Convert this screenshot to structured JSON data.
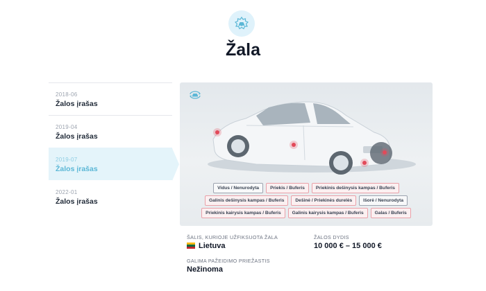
{
  "header": {
    "icon": "car-damage-icon",
    "title": "Žala"
  },
  "timeline": [
    {
      "date": "2018-06",
      "label": "Žalos įrašas",
      "active": false
    },
    {
      "date": "2019-04",
      "label": "Žalos įrašas",
      "active": false
    },
    {
      "date": "2019-07",
      "label": "Žalos įrašas",
      "active": true
    },
    {
      "date": "2022-01",
      "label": "Žalos įrašas",
      "active": false
    }
  ],
  "car_view": {
    "rotate_icon": "rotate-view-icon",
    "tag_rows": [
      [
        {
          "label": "Vidus / Nenurodyta",
          "damaged": false
        },
        {
          "label": "Priekis / Buferis",
          "damaged": true
        },
        {
          "label": "Priekinis dešinysis kampas / Buferis",
          "damaged": true
        }
      ],
      [
        {
          "label": "Galinis dešinysis kampas / Buferis",
          "damaged": true
        },
        {
          "label": "Dešinė / Priekinės durelės",
          "damaged": true
        },
        {
          "label": "Išorė / Nenurodyta",
          "damaged": false
        }
      ],
      [
        {
          "label": "Priekinis kairysis kampas / Buferis",
          "damaged": true
        },
        {
          "label": "Galinis kairysis kampas / Buferis",
          "damaged": true
        },
        {
          "label": "Galas / Buferis",
          "damaged": true
        }
      ]
    ],
    "colors": {
      "damage_marker": "#e24a5a",
      "tag_damaged_border": "#e9a0a8",
      "tag_border": "#9ca3af"
    }
  },
  "details": {
    "country_label": "ŠALIS, KURIOJE UŽFIKSUOTA ŽALA",
    "country_value": "Lietuva",
    "country_flag": "lithuania-flag-icon",
    "size_label": "ŽALOS DYDIS",
    "size_value": "10 000 € – 15 000 €",
    "cause_label": "GALIMA PAŽEIDIMO PRIEŽASTIS",
    "cause_value": "Nežinoma"
  },
  "colors": {
    "accent": "#5bb7d6",
    "active_bg": "#e4f4fa"
  }
}
